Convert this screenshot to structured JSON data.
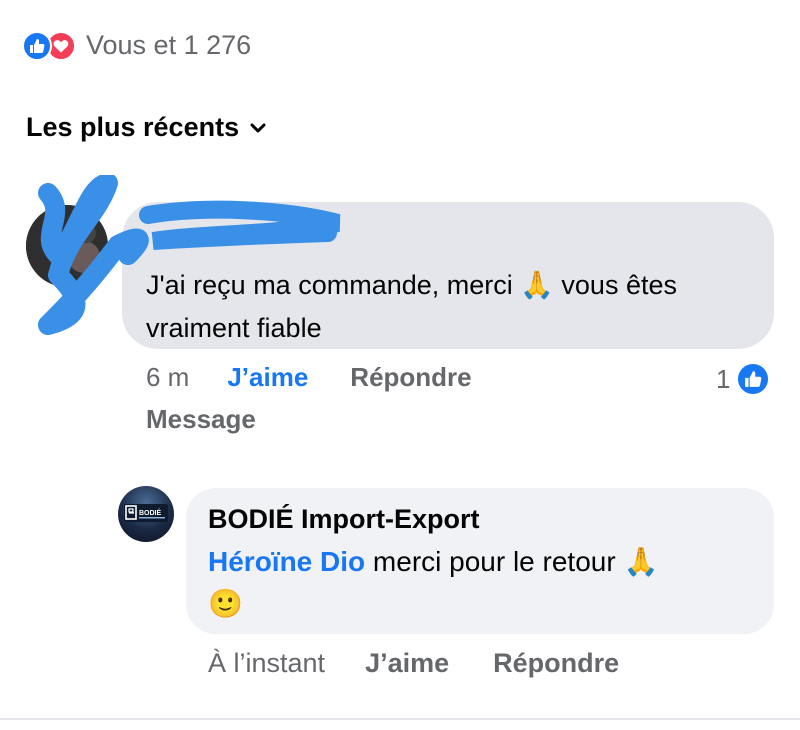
{
  "reactions": {
    "icons": [
      "like-icon",
      "love-icon"
    ],
    "text": "Vous et 1 276",
    "colors": {
      "like": "#1877f2",
      "love": "#f33e58"
    }
  },
  "sort": {
    "label": "Les plus récents"
  },
  "comment": {
    "text_before": "J'ai reçu ma commande, merci ",
    "emoji": "🙏",
    "text_after": " vous êtes vraiment fiable",
    "time": "6 m",
    "like_label": "J’aime",
    "reply_label": "Répondre",
    "message_label": "Message",
    "like_count": "1"
  },
  "reply": {
    "author": "BODIÉ Import-Export",
    "mention": "Héroïne Dio",
    "text": " merci pour le retour ",
    "emoji1": "🙏",
    "emoji2": "🙂",
    "time": "À l’instant",
    "like_label": "J’aime",
    "reply_label": "Répondre",
    "avatar_text": "BODIÉ"
  }
}
